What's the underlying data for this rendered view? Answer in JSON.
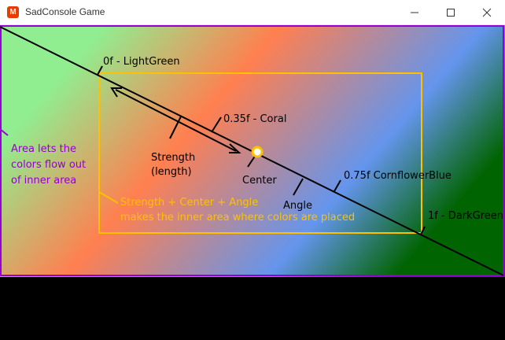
{
  "window": {
    "title": "SadConsole Game",
    "app_icon": "monogame-icon",
    "controls": [
      "minimize-icon",
      "maximize-icon",
      "close-icon"
    ]
  },
  "colors": {
    "light_green": "#90EE90",
    "coral": "#FF7F50",
    "cornflower_blue": "#6495ED",
    "dark_green": "#006400",
    "outer_border": "#9400D3",
    "inner_area": "#FFC000",
    "annotation": "#000000"
  },
  "labels": {
    "stop_0": "0f - LightGreen",
    "stop_035": "0.35f - Coral",
    "stop_075": "0.75f CornflowerBlue",
    "stop_1": "1f - DarkGreen",
    "strength_line1": "Strength",
    "strength_line2": "(length)",
    "center": "Center",
    "angle": "Angle",
    "area_line1": "Area lets the",
    "area_line2": "colors flow out",
    "area_line3": "of inner area",
    "inner_line1": "Strength + Center + Angle",
    "inner_line2": "makes the inner area where colors are placed"
  }
}
